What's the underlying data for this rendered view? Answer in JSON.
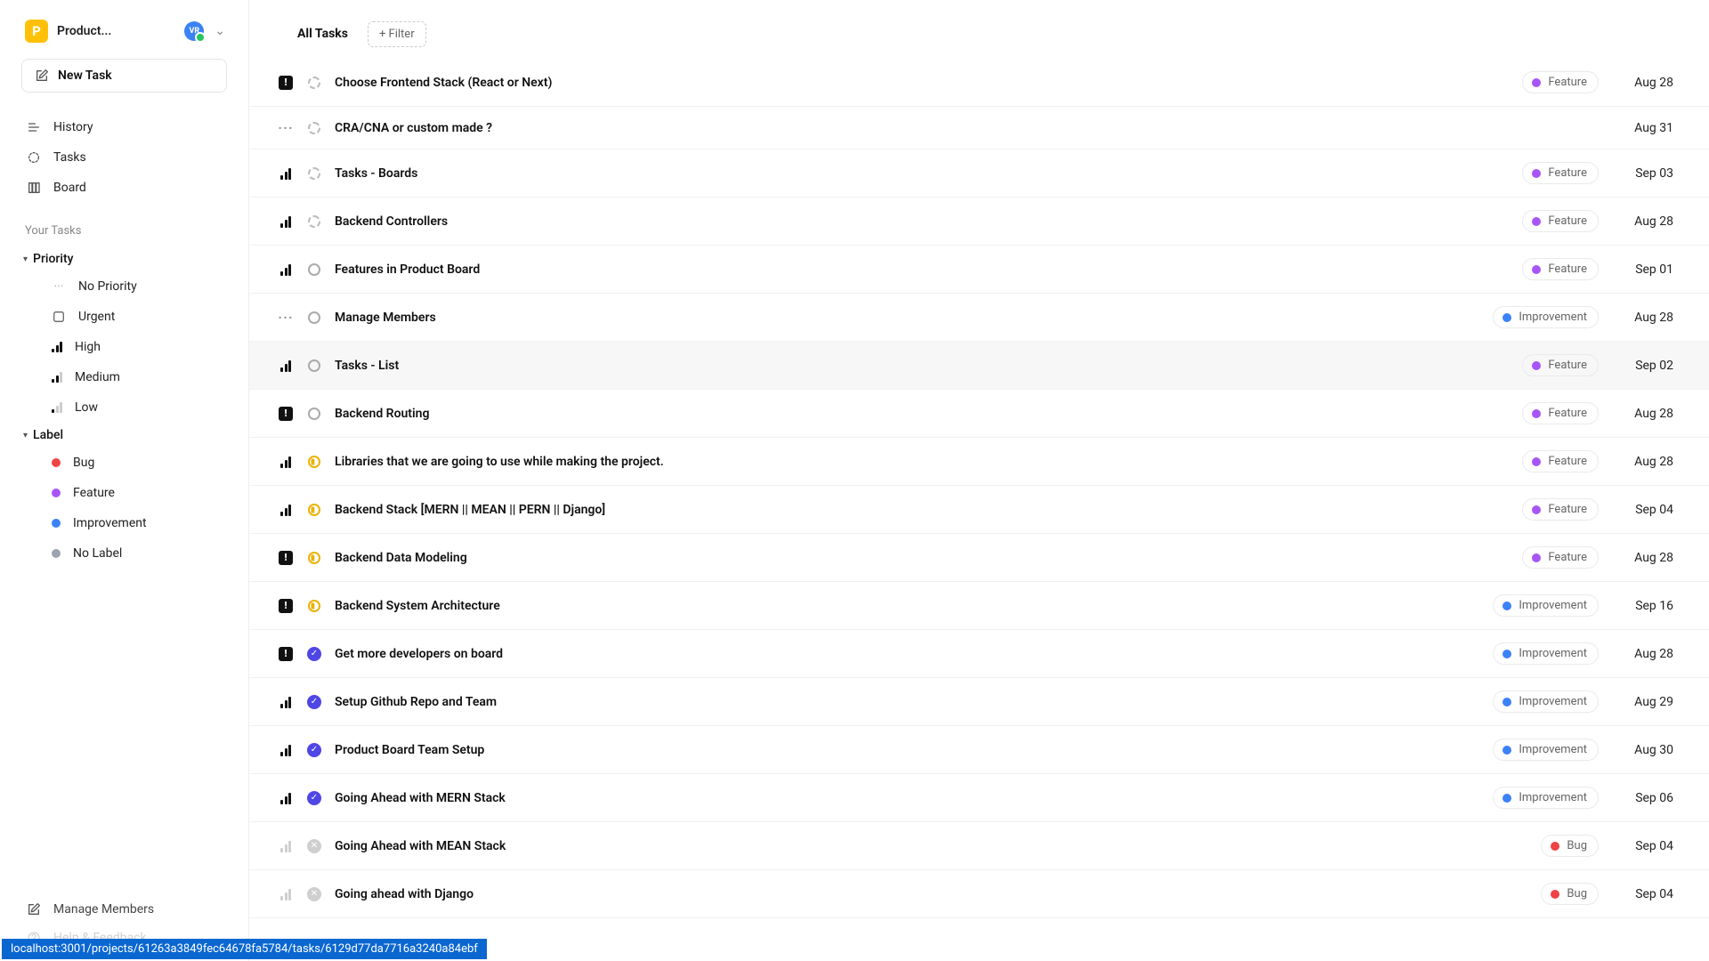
{
  "project": {
    "initial": "P",
    "name": "Product...",
    "avatar": "VR"
  },
  "new_task_label": "New Task",
  "nav": [
    {
      "label": "History"
    },
    {
      "label": "Tasks"
    },
    {
      "label": "Board"
    }
  ],
  "section_label": "Your Tasks",
  "groups": {
    "priority": {
      "label": "Priority",
      "items": [
        {
          "key": "none",
          "label": "No Priority"
        },
        {
          "key": "urgent",
          "label": "Urgent"
        },
        {
          "key": "high",
          "label": "High"
        },
        {
          "key": "medium",
          "label": "Medium"
        },
        {
          "key": "low",
          "label": "Low"
        }
      ]
    },
    "label": {
      "label": "Label",
      "items": [
        {
          "key": "bug",
          "label": "Bug",
          "color": "#ef4444"
        },
        {
          "key": "feature",
          "label": "Feature",
          "color": "#a855f7"
        },
        {
          "key": "improvement",
          "label": "Improvement",
          "color": "#3b82f6"
        },
        {
          "key": "nolabel",
          "label": "No Label",
          "color": "#9ca3af"
        }
      ]
    }
  },
  "footer_nav": [
    {
      "label": "Manage Members"
    },
    {
      "label": "Help & Feedback"
    }
  ],
  "header": {
    "tab": "All Tasks",
    "filter": "+ Filter"
  },
  "label_colors": {
    "Feature": "#a855f7",
    "Improvement": "#3b82f6",
    "Bug": "#ef4444"
  },
  "tasks": [
    {
      "priority": "urgent",
      "status": "backlog",
      "title": "Choose Frontend Stack (React or Next)",
      "label": "Feature",
      "date": "Aug 28"
    },
    {
      "priority": "none",
      "status": "backlog",
      "title": "CRA/CNA or custom made ?",
      "label": null,
      "date": "Aug 31"
    },
    {
      "priority": "high",
      "status": "backlog",
      "title": "Tasks - Boards",
      "label": "Feature",
      "date": "Sep 03"
    },
    {
      "priority": "high",
      "status": "backlog",
      "title": "Backend Controllers",
      "label": "Feature",
      "date": "Aug 28"
    },
    {
      "priority": "high",
      "status": "todo",
      "title": "Features in Product Board",
      "label": "Feature",
      "date": "Sep 01"
    },
    {
      "priority": "none",
      "status": "todo",
      "title": "Manage Members",
      "label": "Improvement",
      "date": "Aug 28"
    },
    {
      "priority": "high",
      "status": "todo",
      "title": "Tasks - List",
      "label": "Feature",
      "date": "Sep 02",
      "hover": true
    },
    {
      "priority": "urgent",
      "status": "todo",
      "title": "Backend Routing",
      "label": "Feature",
      "date": "Aug 28"
    },
    {
      "priority": "high",
      "status": "progress",
      "title": "Libraries that we are going to use while making the project.",
      "label": "Feature",
      "date": "Aug 28"
    },
    {
      "priority": "high",
      "status": "progress",
      "title": "Backend Stack [MERN || MEAN || PERN || Django]",
      "label": "Feature",
      "date": "Sep 04"
    },
    {
      "priority": "urgent",
      "status": "progress",
      "title": "Backend Data Modeling",
      "label": "Feature",
      "date": "Aug 28"
    },
    {
      "priority": "urgent",
      "status": "progress",
      "title": "Backend System Architecture",
      "label": "Improvement",
      "date": "Sep 16"
    },
    {
      "priority": "urgent",
      "status": "done",
      "title": "Get more developers on board",
      "label": "Improvement",
      "date": "Aug 28"
    },
    {
      "priority": "high",
      "status": "done",
      "title": "Setup Github Repo and Team",
      "label": "Improvement",
      "date": "Aug 29"
    },
    {
      "priority": "high",
      "status": "done",
      "title": "Product Board Team Setup",
      "label": "Improvement",
      "date": "Aug 30"
    },
    {
      "priority": "high",
      "status": "done",
      "title": "Going Ahead with MERN Stack",
      "label": "Improvement",
      "date": "Sep 06"
    },
    {
      "priority": "high_faded",
      "status": "cancel",
      "title": "Going Ahead with MEAN Stack",
      "label": "Bug",
      "date": "Sep 04"
    },
    {
      "priority": "high_faded",
      "status": "cancel",
      "title": "Going ahead with Django",
      "label": "Bug",
      "date": "Sep 04"
    }
  ],
  "status_url": "localhost:3001/projects/61263a3849fec64678fa5784/tasks/6129d77da7716a3240a84ebf"
}
